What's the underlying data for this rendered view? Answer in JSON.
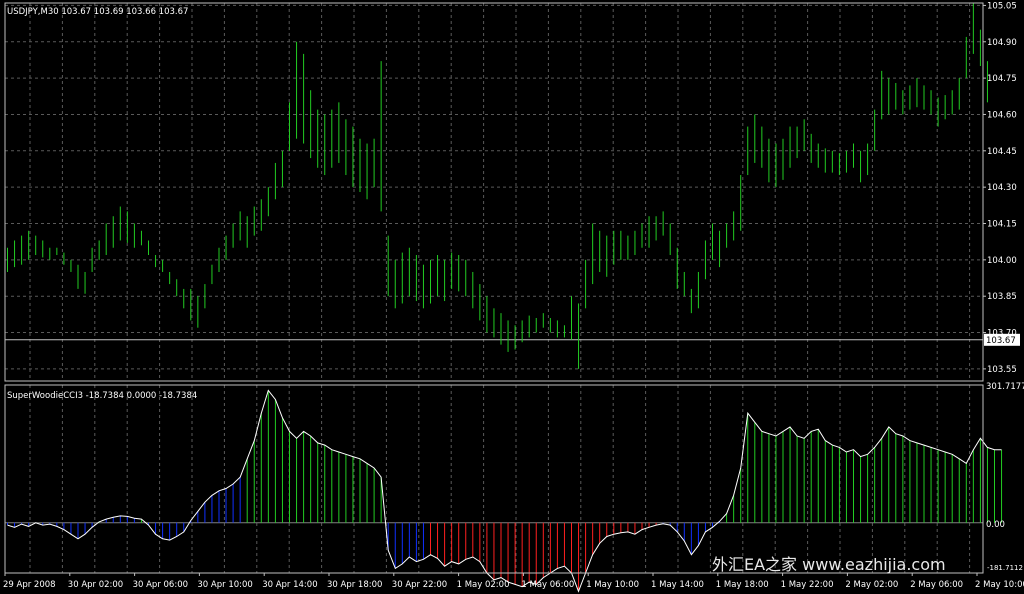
{
  "header": {
    "price_title": "USDJPY,M30  103.67 103.69 103.66 103.67",
    "indicator_title": "SuperWoodieCCI3 -18.7384 0.0000 -18.7384"
  },
  "watermark": "外汇EA之家 www.eazhijia.com",
  "colors": {
    "background": "#000000",
    "grid": "#5a5a5a",
    "bar": "#22cc22",
    "cci_line": "#ffffff",
    "hist_green": "#22cc22",
    "hist_blue": "#1030ff",
    "hist_red": "#ff2020",
    "axis_text": "#ffffff"
  },
  "chart_data": [
    {
      "type": "ohlc",
      "symbol": "USDJPY",
      "timeframe": "M30",
      "ylim": [
        103.5,
        105.06
      ],
      "y_ticks": [
        "105.05",
        "104.90",
        "104.75",
        "104.60",
        "104.45",
        "104.30",
        "104.15",
        "104.00",
        "103.85",
        "103.70",
        "103.55"
      ],
      "current_price_label": "103.67",
      "current_price": 103.67,
      "lows": [
        103.95,
        103.97,
        103.98,
        104.0,
        104.02,
        104.01,
        104.0,
        104.02,
        103.98,
        103.95,
        103.88,
        103.86,
        103.95,
        104.0,
        104.02,
        104.05,
        104.08,
        104.07,
        104.05,
        104.06,
        104.02,
        103.97,
        103.95,
        103.9,
        103.85,
        103.8,
        103.75,
        103.72,
        103.8,
        103.9,
        103.95,
        104.0,
        104.05,
        104.08,
        104.05,
        104.1,
        104.12,
        104.18,
        104.25,
        104.3,
        104.45,
        104.5,
        104.48,
        104.42,
        104.38,
        104.35,
        104.38,
        104.4,
        104.35,
        104.3,
        104.28,
        104.25,
        104.3,
        104.2,
        103.85,
        103.8,
        103.82,
        103.85,
        103.83,
        103.8,
        103.82,
        103.85,
        103.83,
        103.88,
        103.87,
        103.85,
        103.8,
        103.75,
        103.7,
        103.68,
        103.65,
        103.62,
        103.63,
        103.66,
        103.68,
        103.7,
        103.72,
        103.7,
        103.68,
        103.68,
        103.67,
        103.55,
        103.8,
        103.9,
        103.95,
        103.93,
        103.98,
        104.0,
        104.0,
        104.02,
        104.05,
        104.05,
        104.08,
        104.1,
        104.02,
        103.88,
        103.85,
        103.78,
        103.8,
        103.92,
        104.0,
        103.97,
        104.05,
        104.08,
        104.12,
        104.35,
        104.4,
        104.38,
        104.32,
        104.3,
        104.33,
        104.38,
        104.42,
        104.45,
        104.4,
        104.38,
        104.36,
        104.36,
        104.35,
        104.36,
        104.38,
        104.32,
        104.35,
        104.45,
        104.58,
        104.6,
        104.62,
        104.6,
        104.62,
        104.63,
        104.62,
        104.6,
        104.55,
        104.58,
        104.6,
        104.62,
        104.75,
        104.85,
        104.8,
        104.65
      ],
      "highs": [
        104.05,
        104.08,
        104.1,
        104.12,
        104.1,
        104.08,
        104.05,
        104.05,
        104.03,
        104.0,
        103.98,
        103.95,
        104.05,
        104.08,
        104.15,
        104.18,
        104.22,
        104.2,
        104.15,
        104.12,
        104.08,
        104.02,
        104.0,
        103.95,
        103.92,
        103.88,
        103.88,
        103.85,
        103.9,
        103.98,
        104.05,
        104.1,
        104.15,
        104.2,
        104.18,
        104.22,
        104.25,
        104.3,
        104.4,
        104.45,
        104.65,
        104.9,
        104.85,
        104.7,
        104.62,
        104.6,
        104.62,
        104.65,
        104.58,
        104.55,
        104.5,
        104.48,
        104.5,
        104.82,
        104.1,
        104.0,
        104.03,
        104.05,
        104.02,
        103.98,
        104.0,
        104.02,
        104.0,
        104.03,
        104.02,
        104.0,
        103.95,
        103.9,
        103.85,
        103.8,
        103.78,
        103.75,
        103.73,
        103.75,
        103.77,
        103.76,
        103.78,
        103.76,
        103.75,
        103.73,
        103.85,
        103.82,
        104.0,
        104.15,
        104.12,
        104.1,
        104.12,
        104.12,
        104.1,
        104.12,
        104.15,
        104.18,
        104.18,
        104.2,
        104.15,
        104.05,
        103.95,
        103.88,
        103.95,
        104.08,
        104.15,
        104.12,
        104.15,
        104.2,
        104.35,
        104.55,
        104.6,
        104.55,
        104.5,
        104.48,
        104.5,
        104.55,
        104.55,
        104.58,
        104.52,
        104.48,
        104.46,
        104.45,
        104.44,
        104.45,
        104.48,
        104.45,
        104.48,
        104.62,
        104.78,
        104.75,
        104.73,
        104.7,
        104.72,
        104.75,
        104.72,
        104.7,
        104.67,
        104.68,
        104.7,
        104.75,
        104.92,
        105.06,
        104.95,
        104.82
      ]
    },
    {
      "type": "indicator-histogram",
      "name": "SuperWoodieCCI3",
      "ylim": [
        -110,
        301.7177
      ],
      "y_ticks": [
        "301.7177",
        "0.00"
      ],
      "bottom_tick": "-181.7112",
      "values": [
        -5,
        -10,
        -3,
        -8,
        0,
        -5,
        -3,
        -8,
        -15,
        -25,
        -35,
        -25,
        -10,
        2,
        8,
        12,
        15,
        14,
        10,
        8,
        -5,
        -25,
        -35,
        -38,
        -30,
        -20,
        5,
        25,
        45,
        60,
        70,
        75,
        85,
        100,
        140,
        180,
        240,
        290,
        270,
        230,
        200,
        185,
        200,
        190,
        175,
        170,
        160,
        155,
        150,
        145,
        140,
        130,
        120,
        100,
        -60,
        -100,
        -90,
        -75,
        -85,
        -80,
        -70,
        -78,
        -95,
        -85,
        -90,
        -80,
        -75,
        -85,
        -110,
        -125,
        -120,
        -130,
        -135,
        -140,
        -130,
        -135,
        -120,
        -110,
        -100,
        -95,
        -110,
        -150,
        -110,
        -70,
        -45,
        -30,
        -25,
        -22,
        -20,
        -25,
        -15,
        -10,
        -5,
        -2,
        -5,
        -20,
        -40,
        -70,
        -50,
        -20,
        -10,
        3,
        20,
        60,
        120,
        240,
        220,
        200,
        195,
        190,
        200,
        210,
        190,
        185,
        200,
        205,
        180,
        170,
        165,
        155,
        160,
        145,
        150,
        165,
        185,
        210,
        195,
        190,
        180,
        175,
        170,
        165,
        160,
        155,
        150,
        140,
        130,
        160,
        185,
        165,
        160,
        160
      ],
      "colors": [
        "b",
        "b",
        "b",
        "b",
        "g",
        "b",
        "b",
        "b",
        "b",
        "b",
        "b",
        "b",
        "b",
        "g",
        "b",
        "b",
        "b",
        "b",
        "b",
        "g",
        "b",
        "b",
        "b",
        "b",
        "b",
        "b",
        "b",
        "b",
        "b",
        "b",
        "b",
        "b",
        "b",
        "b",
        "g",
        "g",
        "g",
        "g",
        "g",
        "g",
        "g",
        "g",
        "g",
        "g",
        "g",
        "g",
        "g",
        "g",
        "g",
        "g",
        "g",
        "g",
        "g",
        "g",
        "b",
        "b",
        "b",
        "b",
        "b",
        "b",
        "r",
        "r",
        "r",
        "r",
        "r",
        "r",
        "r",
        "r",
        "r",
        "r",
        "r",
        "r",
        "r",
        "r",
        "r",
        "r",
        "r",
        "r",
        "r",
        "r",
        "r",
        "r",
        "r",
        "r",
        "r",
        "r",
        "r",
        "r",
        "r",
        "r",
        "r",
        "r",
        "r",
        "b",
        "b",
        "b",
        "b",
        "b",
        "b",
        "b",
        "b",
        "b",
        "g",
        "g",
        "g",
        "g",
        "g",
        "g",
        "g",
        "g",
        "g",
        "g",
        "g",
        "g",
        "g",
        "g",
        "g",
        "g",
        "g",
        "g",
        "g",
        "g",
        "g",
        "g",
        "g",
        "g",
        "g",
        "g",
        "g",
        "g",
        "g",
        "g",
        "g",
        "g",
        "g",
        "g",
        "g",
        "g",
        "g",
        "g",
        "g",
        "g"
      ]
    }
  ],
  "x_axis": {
    "labels": [
      "29 Apr 2008",
      "30 Apr 02:00",
      "30 Apr 06:00",
      "30 Apr 10:00",
      "30 Apr 14:00",
      "30 Apr 18:00",
      "30 Apr 22:00",
      "1 May 02:00",
      "1 May 06:00",
      "1 May 10:00",
      "1 May 14:00",
      "1 May 18:00",
      "1 May 22:00",
      "2 May 02:00",
      "2 May 06:00",
      "2 May 10:00"
    ]
  }
}
